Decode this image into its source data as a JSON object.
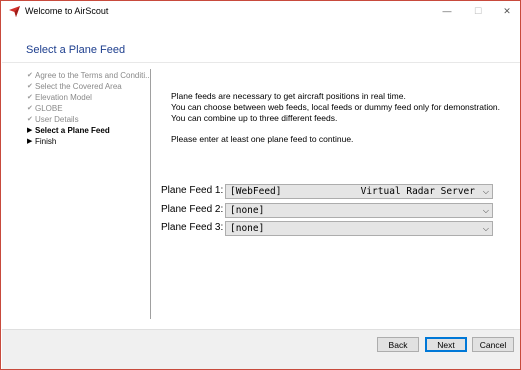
{
  "window": {
    "title": "Welcome to AirScout",
    "minimize_glyph": "—",
    "maximize_glyph": "☐",
    "close_glyph": "✕"
  },
  "header": {
    "title": "Select a Plane Feed"
  },
  "nav": {
    "items": [
      {
        "label": "Agree to the Terms and Conditi...",
        "state": "done",
        "mark": "✔"
      },
      {
        "label": "Select the Covered Area",
        "state": "done",
        "mark": "✔"
      },
      {
        "label": "Elevation Model",
        "state": "done",
        "mark": "✔"
      },
      {
        "label": "GLOBE",
        "state": "done",
        "mark": "✔"
      },
      {
        "label": "User Details",
        "state": "done",
        "mark": "✔"
      },
      {
        "label": "Select a Plane Feed",
        "state": "current",
        "mark": "▶"
      },
      {
        "label": "Finish",
        "state": "pending",
        "mark": "▶"
      }
    ]
  },
  "main": {
    "info_lines": [
      "Plane feeds are necessary to get aircraft positions in real time.",
      "You can choose between web feeds, local feeds or dummy feed only for demonstration.",
      "You can combine up to three different feeds."
    ],
    "prompt": "Please enter at least one plane feed to continue.",
    "feeds": [
      {
        "label": "Plane Feed 1:",
        "value": "[WebFeed]",
        "extra": "Virtual Radar Server"
      },
      {
        "label": "Plane Feed 2:",
        "value": "[none]",
        "extra": ""
      },
      {
        "label": "Plane Feed 3:",
        "value": "[none]",
        "extra": ""
      }
    ]
  },
  "footer": {
    "back_label": "Back",
    "next_label": "Next",
    "cancel_label": "Cancel"
  },
  "icons": {
    "app": "airscout-logo-icon",
    "dropdown": "chevron-down-icon"
  },
  "colors": {
    "header_title": "#1d3e8e",
    "window_border": "#c84a3c",
    "default_button_border": "#0078d7"
  }
}
